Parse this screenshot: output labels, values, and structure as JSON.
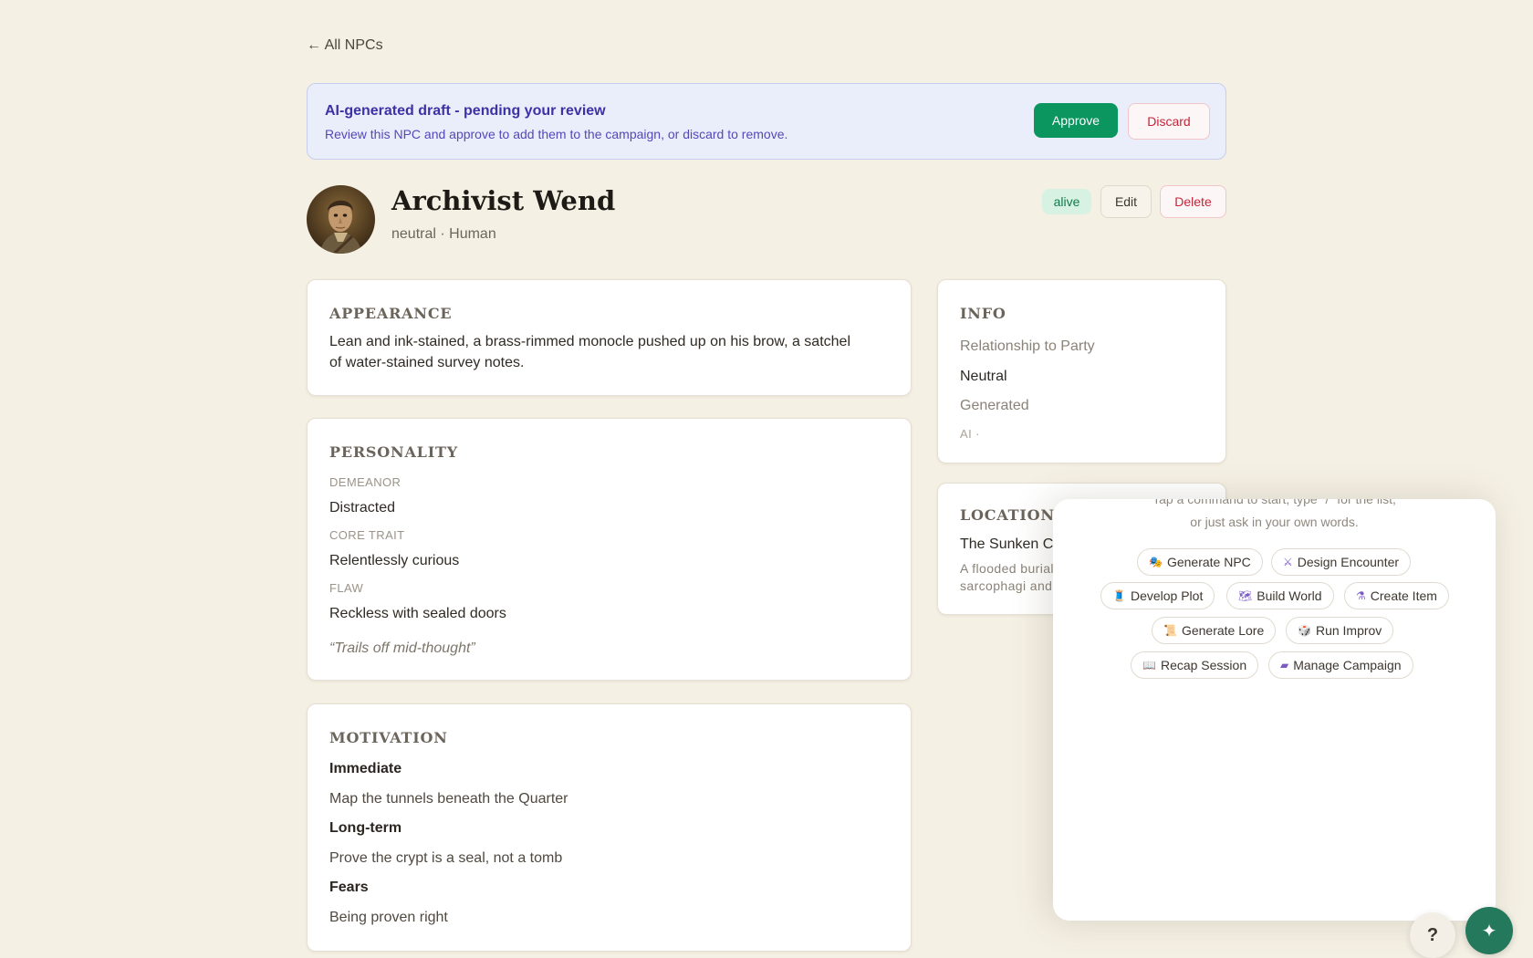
{
  "nav": {
    "back_label": "← All NPCs"
  },
  "banner": {
    "title": "AI-generated draft - pending your review",
    "description": "Review this NPC and approve to add them to the campaign, or discard to remove.",
    "approve_label": "Approve",
    "discard_label": "Discard"
  },
  "npc": {
    "name": "Archivist Wend",
    "subtitle": "neutral · Human",
    "status_badge": "alive",
    "edit_label": "Edit",
    "delete_label": "Delete"
  },
  "appearance": {
    "title": "APPEARANCE",
    "text_line1": "Lean and ink-stained, a brass-rimmed monocle pushed up on his brow, a satchel",
    "text_line2": "of water-stained survey notes."
  },
  "personality": {
    "title": "PERSONALITY",
    "demeanor_label": "DEMEANOR",
    "demeanor": "Distracted",
    "core_trait_label": "CORE TRAIT",
    "core_trait": "Relentlessly curious",
    "flaw_label": "FLAW",
    "flaw": "Reckless with sealed doors",
    "quote": "“Trails off mid-thought”"
  },
  "motivation": {
    "title": "MOTIVATION",
    "immediate_label": "Immediate",
    "immediate": "Map the tunnels beneath the Quarter",
    "long_term_label": "Long-term",
    "long_term": "Prove the crypt is a seal, not a tomb",
    "fears_label": "Fears",
    "fears": "Being proven right"
  },
  "info": {
    "title": "INFO",
    "relationship_label": "Relationship to Party",
    "relationship": "Neutral",
    "generated_label": "Generated",
    "generated_value": "AI ·"
  },
  "location": {
    "title": "LOCATION",
    "name": "The Sunken C",
    "desc_line1": "A flooded burial",
    "desc_line2": "sarcophagi and"
  },
  "assistant": {
    "hint_line1": "Tap a command to start, type \"/\" for the list,",
    "hint_line2": "or just ask in your own words.",
    "commands": [
      {
        "icon": "🎭",
        "label": "Generate NPC"
      },
      {
        "icon": "⚔",
        "label": "Design Encounter"
      },
      {
        "icon": "🧵",
        "label": "Develop Plot"
      },
      {
        "icon": "🗺",
        "label": "Build World"
      },
      {
        "icon": "⚗",
        "label": "Create Item"
      },
      {
        "icon": "📜",
        "label": "Generate Lore"
      },
      {
        "icon": "🎲",
        "label": "Run Improv"
      },
      {
        "icon": "📖",
        "label": "Recap Session"
      },
      {
        "icon": "▰",
        "label": "Manage Campaign"
      }
    ]
  },
  "fabs": {
    "help_label": "?",
    "assistant_label": "✦"
  },
  "colors": {
    "accent_green": "#0b9660",
    "danger": "#c4243a",
    "banner_bg": "#eaeefa",
    "page_bg": "#f5f0e4"
  }
}
